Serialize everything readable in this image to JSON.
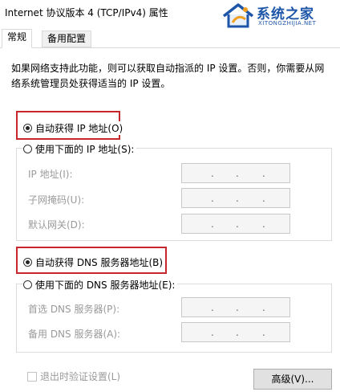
{
  "window": {
    "title": "Internet 协议版本 4 (TCP/IPv4) 属性"
  },
  "watermark": {
    "name": "系统之家",
    "url": "XITONGZHIJIA.NET"
  },
  "tabs": [
    {
      "label": "常规",
      "active": true
    },
    {
      "label": "备用配置",
      "active": false
    }
  ],
  "description": "如果网络支持此功能，则可以获取自动指派的 IP 设置。否则，你需要从网络系统管理员处获得适当的 IP 设置。",
  "ip": {
    "auto_label": "自动获得 IP 地址(O)",
    "auto_checked": true,
    "manual_label": "使用下面的 IP 地址(S):",
    "manual_checked": false,
    "fields": [
      {
        "label": "IP 地址(I):",
        "value": ". . ."
      },
      {
        "label": "子网掩码(U):",
        "value": ". . ."
      },
      {
        "label": "默认网关(D):",
        "value": ". . ."
      }
    ]
  },
  "dns": {
    "auto_label": "自动获得 DNS 服务器地址(B)",
    "auto_checked": true,
    "manual_label": "使用下面的 DNS 服务器地址(E):",
    "manual_checked": false,
    "fields": [
      {
        "label": "首选 DNS 服务器(P):",
        "value": ". . ."
      },
      {
        "label": "备用 DNS 服务器(A):",
        "value": ". . ."
      }
    ]
  },
  "validate_on_exit": {
    "label": "退出时验证设置(L)",
    "checked": false,
    "enabled": false
  },
  "advanced_button": "高级(V)...",
  "colors": {
    "highlight_box": "#c8262d",
    "brand": "#1d56a8"
  }
}
